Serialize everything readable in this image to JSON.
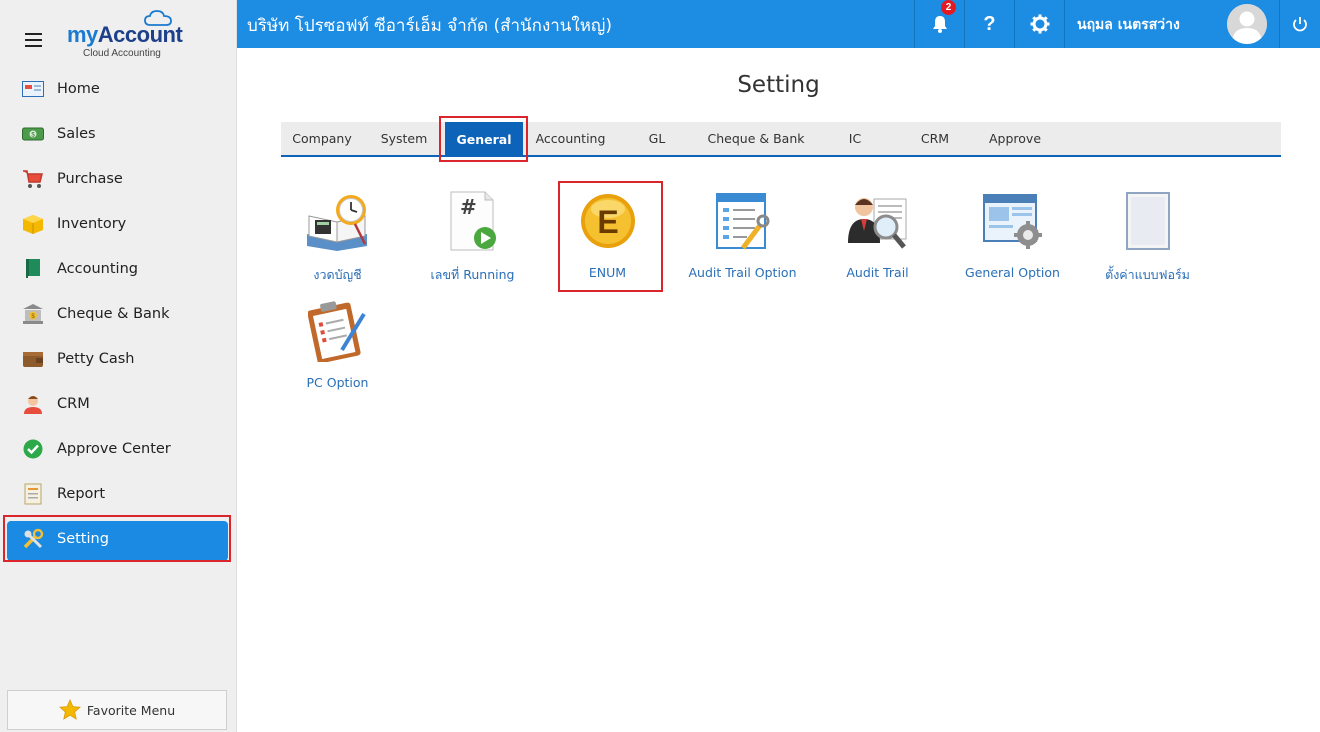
{
  "brand": {
    "name_part1": "my",
    "name_part2": "Account",
    "subtitle": "Cloud Accounting"
  },
  "sidebar": {
    "items": [
      {
        "label": "Home",
        "icon": "home-icon"
      },
      {
        "label": "Sales",
        "icon": "sales-icon"
      },
      {
        "label": "Purchase",
        "icon": "cart-icon"
      },
      {
        "label": "Inventory",
        "icon": "box-icon"
      },
      {
        "label": "Accounting",
        "icon": "book-icon"
      },
      {
        "label": "Cheque & Bank",
        "icon": "bank-icon"
      },
      {
        "label": "Petty Cash",
        "icon": "wallet-icon"
      },
      {
        "label": "CRM",
        "icon": "person-icon"
      },
      {
        "label": "Approve Center",
        "icon": "check-icon"
      },
      {
        "label": "Report",
        "icon": "report-icon"
      },
      {
        "label": "Setting",
        "icon": "tools-icon",
        "active": true
      }
    ],
    "favorite_label": "Favorite Menu"
  },
  "header": {
    "company": "บริษัท โปรซอฟท์ ซีอาร์เอ็ม จำกัด (สำนักงานใหญ่)",
    "notification_count": "2",
    "help_label": "?",
    "user_name": "นฤมล เนตรสว่าง"
  },
  "main": {
    "title": "Setting",
    "tabs": [
      {
        "label": "Company"
      },
      {
        "label": "System"
      },
      {
        "label": "General",
        "active": true
      },
      {
        "label": "Accounting"
      },
      {
        "label": "GL"
      },
      {
        "label": "Cheque & Bank"
      },
      {
        "label": "IC"
      },
      {
        "label": "CRM"
      },
      {
        "label": "Approve"
      }
    ],
    "items": [
      {
        "label": "งวดบัญชี",
        "icon": "calendar-book-icon"
      },
      {
        "label": "เลขที่ Running",
        "icon": "running-number-icon"
      },
      {
        "label": "ENUM",
        "icon": "enum-coin-icon"
      },
      {
        "label": "Audit Trail Option",
        "icon": "audit-option-icon"
      },
      {
        "label": "Audit Trail",
        "icon": "audit-trail-icon"
      },
      {
        "label": "General Option",
        "icon": "general-option-icon"
      },
      {
        "label": "ตั้งค่าแบบฟอร์ม",
        "icon": "form-setting-icon"
      },
      {
        "label": "PC Option",
        "icon": "clipboard-icon"
      }
    ]
  },
  "colors": {
    "topbar": "#1d8ce3",
    "active_tab": "#0d63b8",
    "highlight": "#d9252b",
    "link": "#2a6fb7"
  }
}
